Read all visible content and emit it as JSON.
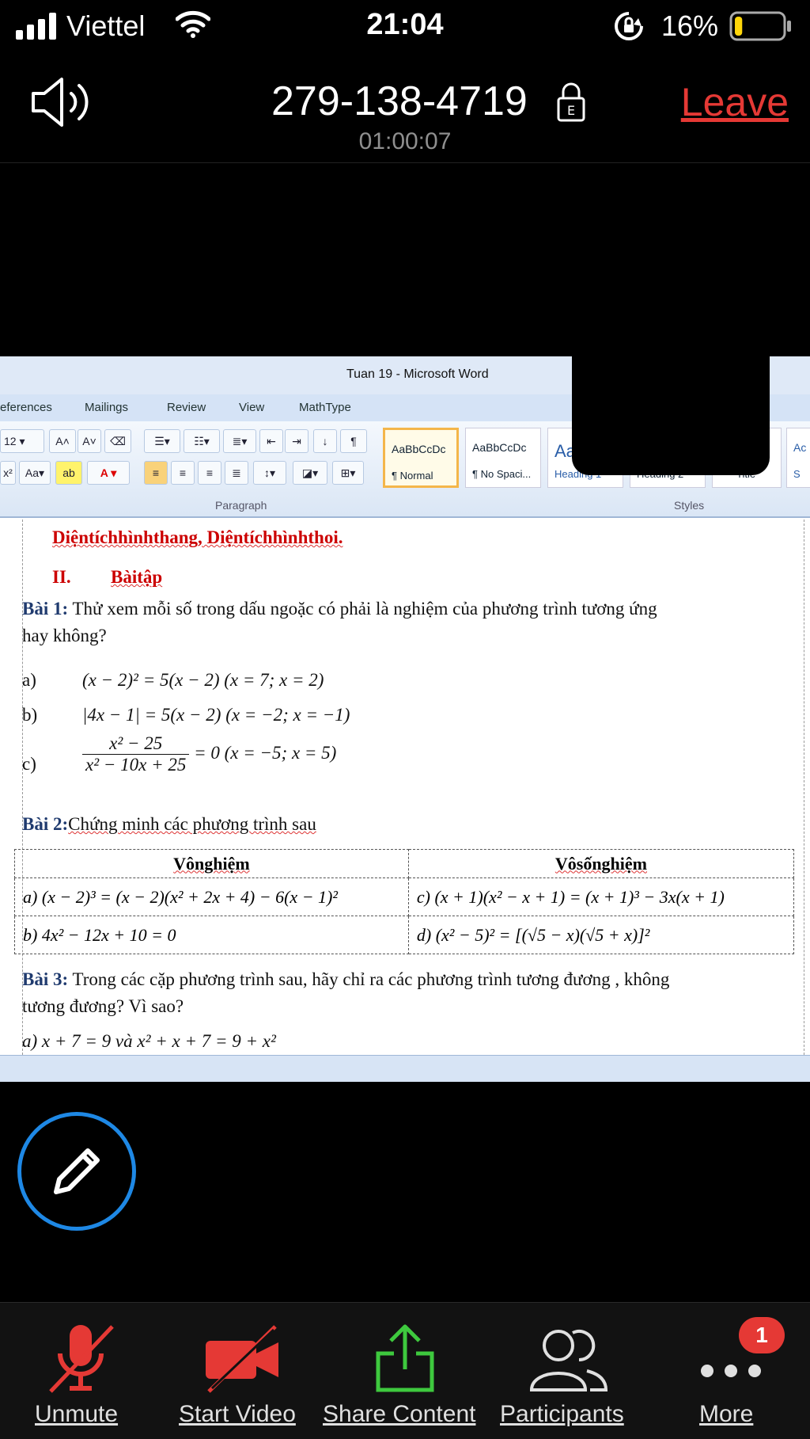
{
  "status_bar": {
    "carrier": "Viettel",
    "time": "21:04",
    "battery_percent": "16%",
    "battery_level": 0.16
  },
  "meeting": {
    "meeting_id": "279-138-4719",
    "duration": "01:00:07",
    "leave_label": "Leave"
  },
  "word": {
    "window_title": "Tuan 19 - Microsoft Word",
    "menu": [
      "eferences",
      "Mailings",
      "Review",
      "View",
      "MathType"
    ],
    "font_size": "12",
    "groups": {
      "paragraph": "Paragraph",
      "styles": "Styles"
    },
    "style_cards": [
      {
        "preview": "AaBbCcDc",
        "name": "¶ Normal"
      },
      {
        "preview": "AaBbCcDc",
        "name": "¶ No Spaci..."
      },
      {
        "preview": "Aa",
        "name": "Heading 1"
      },
      {
        "preview": "",
        "name": "Heading 2"
      },
      {
        "preview": "",
        "name": "Title"
      },
      {
        "preview": "Ac",
        "name": "S"
      }
    ]
  },
  "document": {
    "topics": "Diệntíchhìnhthang, Diệntíchhìnhthoi.",
    "section_num": "II.",
    "section_title": "Bàitập",
    "bai1_label": "Bài 1:",
    "bai1_text": "Thử xem mỗi số trong dấu ngoặc có phải là nghiệm của phương trình tương ứng",
    "bai1_text2": "hay không?",
    "items": [
      {
        "label": "a)",
        "math": "(x − 2)² = 5(x − 2) (x = 7; x = 2)"
      },
      {
        "label": "b)",
        "math": "|4x − 1| = 5(x − 2) (x = −2; x = −1)"
      },
      {
        "label": "c)",
        "numerator": "x² − 25",
        "denominator": "x² − 10x + 25",
        "rest": "= 0 (x = −5; x = 5)"
      }
    ],
    "bai2_label": "Bài 2:",
    "bai2_text": "Chứng minh các phương trình sau",
    "table": {
      "headers": [
        "Vônghiệm",
        "Vôsốnghiệm"
      ],
      "rows": [
        [
          "a) (x − 2)³ = (x − 2)(x² + 2x + 4) − 6(x − 1)²",
          "c) (x + 1)(x² − x + 1) = (x + 1)³ − 3x(x + 1)"
        ],
        [
          "b) 4x² − 12x + 10 = 0",
          "d) (x² − 5)² = [(√5 − x)(√5 + x)]²"
        ]
      ]
    },
    "bai3_label": "Bài 3:",
    "bai3_text": "Trong các cặp phương trình sau, hãy chỉ ra các  phương trình tương đương , không",
    "bai3_text2": "tương đương? Vì sao?",
    "bai3_a": "a) x + 7 = 9 và x² + x + 7 = 9 + x²"
  },
  "toolbar": {
    "unmute": "Unmute",
    "start_video": "Start Video",
    "share_content": "Share Content",
    "participants": "Participants",
    "more": "More",
    "more_badge": "1"
  },
  "colors": {
    "leave": "#e53935",
    "share": "#3ec93e",
    "muted": "#e53935",
    "annotate_ring": "#1e88e5"
  },
  "icons": [
    "signal-icon",
    "wifi-icon",
    "rotation-lock-icon",
    "battery-icon",
    "speaker-icon",
    "padlock-icon",
    "pencil-icon",
    "microphone-muted-icon",
    "video-off-icon",
    "share-upload-icon",
    "participants-icon",
    "more-dots-icon"
  ]
}
